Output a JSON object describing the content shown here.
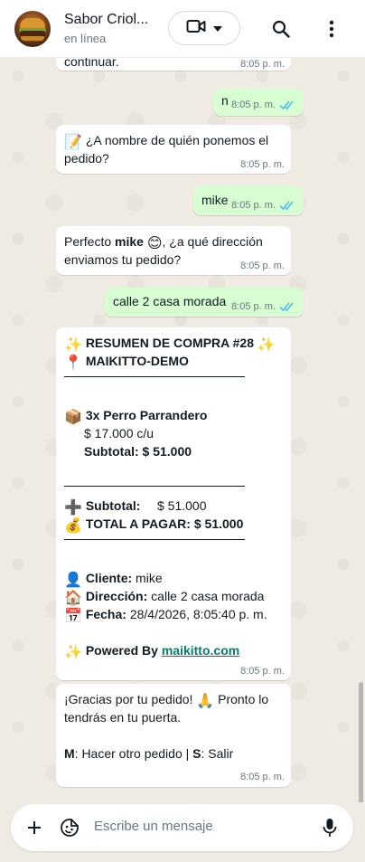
{
  "header": {
    "contact_name": "Sabor Criol...",
    "status": "en línea",
    "icons": [
      "video-call-icon",
      "chevron-down-icon",
      "search-icon",
      "menu-dots-icon"
    ]
  },
  "messages": [
    {
      "dir": "in",
      "text": "continuar.",
      "time": "8:05 p. m."
    },
    {
      "dir": "out",
      "text": "n",
      "time": "8:05 p. m."
    },
    {
      "dir": "in",
      "emoji": "📝",
      "text": "¿A nombre de quién ponemos el pedido?",
      "line1": "¿A nombre de quién ponemos el",
      "line2": "pedido?",
      "time": "8:05 p. m."
    },
    {
      "dir": "out",
      "text": "mike",
      "time": "8:05 p. m."
    },
    {
      "dir": "in",
      "prefix": "Perfecto ",
      "bold": "mike",
      "emoji": "😊",
      "suffix": ", ¿a qué dirección",
      "line2": "enviamos tu pedido?",
      "time": "8:05 p. m."
    },
    {
      "dir": "out",
      "text": "calle 2 casa morada",
      "time": "8:05 p. m."
    }
  ],
  "summary": {
    "title_line1": "RESUMEN DE COMPRA #28",
    "title_line2": "MAIKITTO-DEMO",
    "item_name": "3x Perro Parrandero",
    "item_price": "$ 17.000 c/u",
    "item_subtotal_label": "Subtotal:",
    "item_subtotal": "$ 51.000",
    "subtotal_label": "Subtotal:",
    "subtotal_value": "$ 51.000",
    "total_label": "TOTAL A PAGAR:",
    "total_value": "$ 51.000",
    "client_label": "Cliente:",
    "client_value": "mike",
    "address_label": "Dirección:",
    "address_value": "calle 2 casa morada",
    "date_label": "Fecha:",
    "date_value": "28/4/2026, 8:05:40 p. m.",
    "powered_label": "Powered By",
    "powered_link": "maikitto.com",
    "time": "8:05 p. m."
  },
  "thanks": {
    "line1": "¡Gracias por tu pedido!",
    "line1b": "Pronto lo",
    "line2": "tendrás en tu puerta.",
    "opt_m_key": "M",
    "opt_m_text": ": Hacer otro pedido | ",
    "opt_s_key": "S",
    "opt_s_text": ": Salir",
    "time": "8:05 p. m."
  },
  "composer": {
    "placeholder": "Escribe un mensaje"
  },
  "colors": {
    "outgoing_bubble": "#d9fdd3",
    "incoming_bubble": "#ffffff",
    "read_ticks": "#53bdeb",
    "chat_background": "#efeae2",
    "link": "#008069"
  }
}
